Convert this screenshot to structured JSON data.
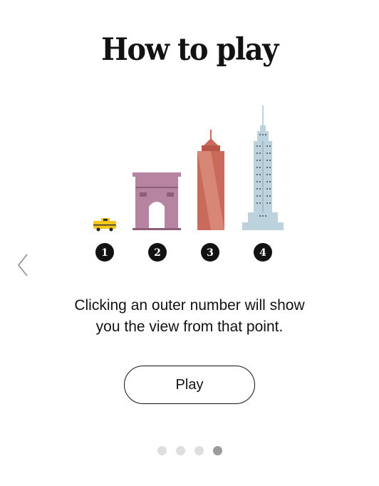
{
  "title": "How to play",
  "steps": [
    {
      "number": "1",
      "landmark": "taxi-icon"
    },
    {
      "number": "2",
      "landmark": "arch-icon"
    },
    {
      "number": "3",
      "landmark": "skyscraper-icon"
    },
    {
      "number": "4",
      "landmark": "empire-state-icon"
    }
  ],
  "instruction_line1": "Clicking an outer number will show",
  "instruction_line2": "you the view from that point.",
  "play_label": "Play",
  "pagination": {
    "total": 4,
    "active_index": 3
  },
  "colors": {
    "taxi": "#f5c518",
    "arch": "#b684a0",
    "skyscraper": "#c96a5b",
    "empire_state": "#bcd3de",
    "text": "#121212",
    "dot_inactive": "#dedede",
    "dot_active": "#9b9b9b"
  }
}
